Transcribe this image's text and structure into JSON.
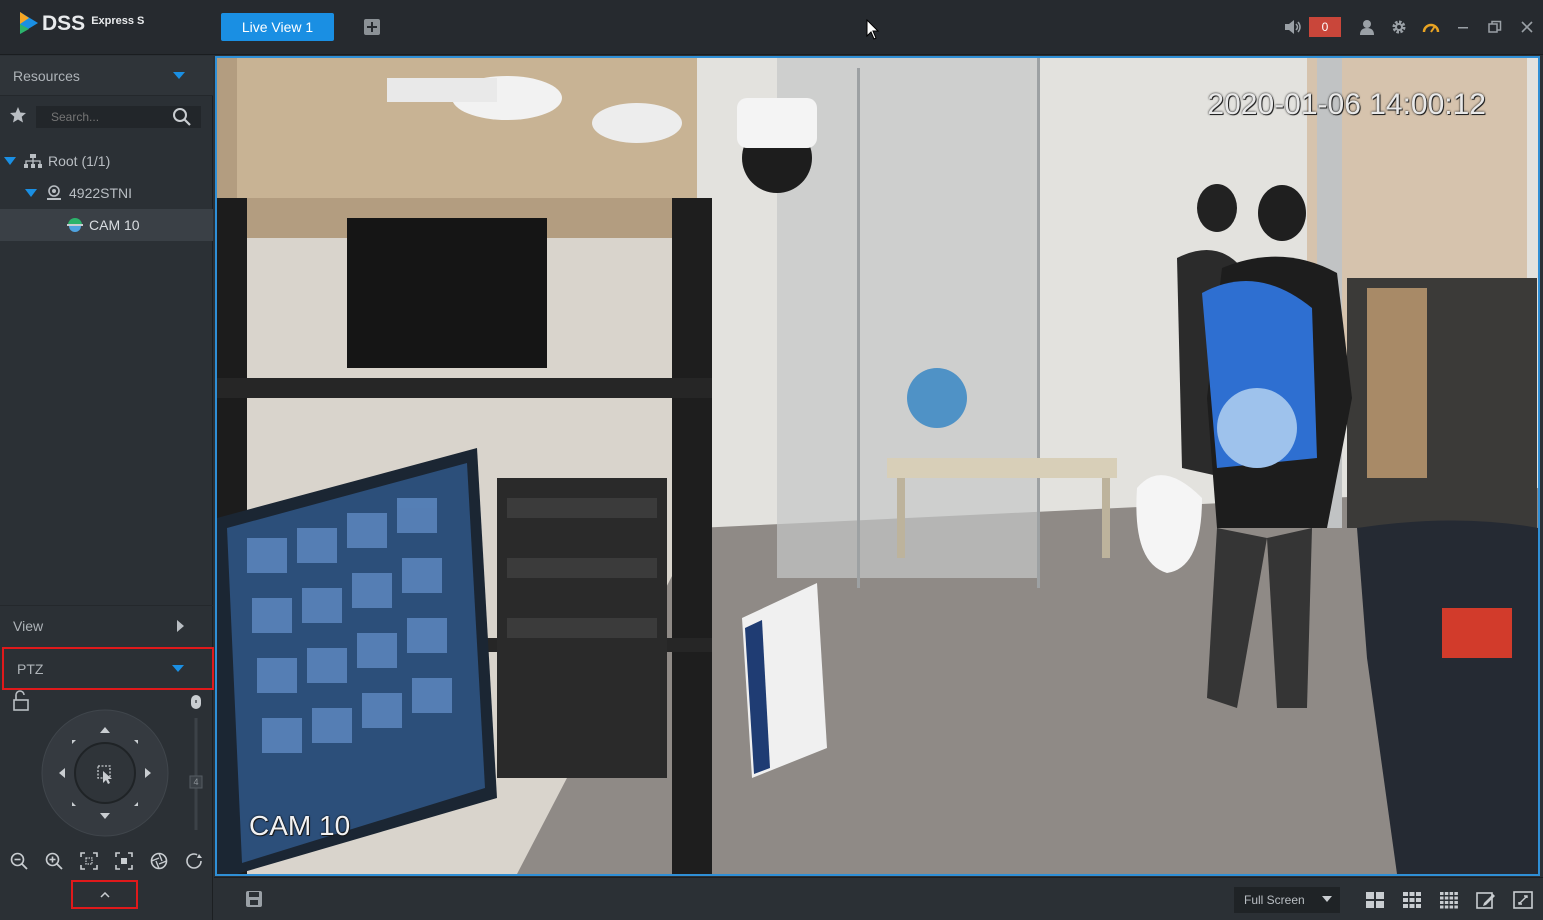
{
  "app": {
    "logo_text": "DSS",
    "logo_subtitle": "Express S"
  },
  "tabs": [
    {
      "label": "Live View 1",
      "active": true
    }
  ],
  "toolbar": {
    "alarm_count": "0"
  },
  "resources": {
    "header": "Resources",
    "search_placeholder": "Search...",
    "tree": [
      {
        "label": "Root (1/1)",
        "level": 0,
        "icon": "org-icon"
      },
      {
        "label": "4922STNI",
        "level": 1,
        "icon": "nvr-icon"
      },
      {
        "label": "CAM 10",
        "level": 2,
        "icon": "ptz-camera-icon",
        "selected": true
      }
    ]
  },
  "sections": {
    "view": "View",
    "ptz": "PTZ"
  },
  "video": {
    "timestamp": "2020-01-06 14:00:12",
    "channel_name": "CAM 10"
  },
  "bottom": {
    "screen_mode": "Full Screen"
  },
  "colors": {
    "accent": "#1a8fe3",
    "highlight_box": "#e0191b",
    "alarm": "#c9463a",
    "panel_bg": "#2b3035"
  }
}
